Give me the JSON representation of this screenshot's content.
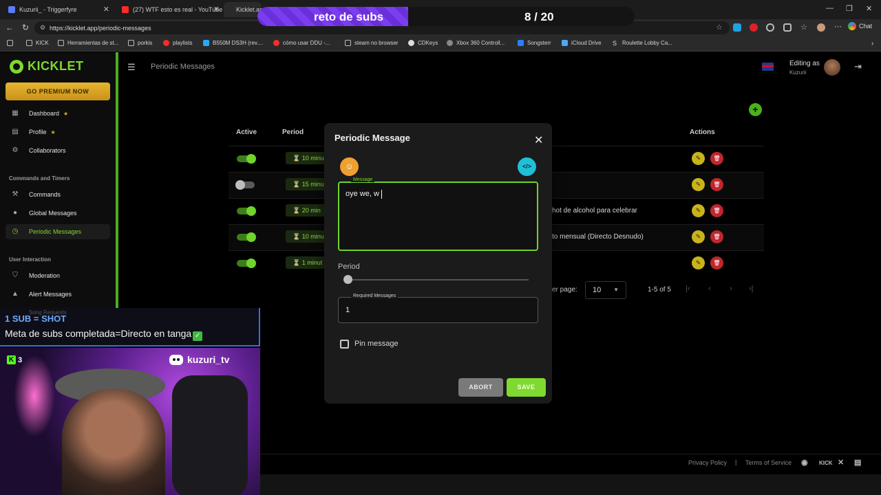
{
  "browser": {
    "tabs": [
      {
        "label": "Kuzurii_ - Triggerfyre",
        "color": "#5b7cff"
      },
      {
        "label": "(27) WTF esto es real - YouTube",
        "color": "#ff2a2a"
      },
      {
        "label": "Kicklet.ap",
        "color": "#53fc18"
      }
    ],
    "url": "https://kicklet.app/periodic-messages",
    "chat_label": "Chat",
    "bookmarks": [
      {
        "label": "KICK",
        "color": "#53fc18"
      },
      {
        "label": "Herramientas de st...",
        "color": "#cfcfcf"
      },
      {
        "label": "porkis",
        "color": "#cfcfcf"
      },
      {
        "label": "playlists",
        "color": "#ff2a2a"
      },
      {
        "label": "B550M DS3H (rev....",
        "color": "#2aa7ff"
      },
      {
        "label": "cómo usar DDU -...",
        "color": "#ff2a2a"
      },
      {
        "label": "steam no browser",
        "color": "#cfcfcf"
      },
      {
        "label": "CDKeys",
        "color": "#cfcfcf"
      },
      {
        "label": "Xbox 360 Controll...",
        "color": "#cfcfcf"
      },
      {
        "label": "Songsterr",
        "color": "#2a7fff"
      },
      {
        "label": "iCloud Drive",
        "color": "#4aa8ff"
      },
      {
        "label": "Roulette Lobby Ca...",
        "color": "#cfcfcf"
      }
    ]
  },
  "sub_goal": {
    "label": "reto de subs",
    "current": 8,
    "target": 20,
    "count_text": "8 / 20"
  },
  "sidebar": {
    "logo": "KICKLET",
    "premium": "GO PREMIUM NOW",
    "items": [
      {
        "label": "Dashboard",
        "icon": "dashboard-icon",
        "star": true
      },
      {
        "label": "Profile",
        "icon": "profile-icon",
        "star": true
      },
      {
        "label": "Collaborators",
        "icon": "collaborators-icon",
        "star": false
      }
    ],
    "section_commands": "Commands and Timers",
    "commands_items": [
      {
        "label": "Commands",
        "icon": "wrench-icon"
      },
      {
        "label": "Global Messages",
        "icon": "chat-icon"
      },
      {
        "label": "Periodic Messages",
        "icon": "clock-icon",
        "active": true
      }
    ],
    "section_user": "User Interaction",
    "user_items": [
      {
        "label": "Moderation",
        "icon": "shield-icon"
      },
      {
        "label": "Alert Messages",
        "icon": "warning-icon"
      }
    ],
    "faded_item": "Song Requests"
  },
  "header": {
    "page_title": "Periodic Messages",
    "editing_as": "Editing as",
    "username": "Kuzurii"
  },
  "table": {
    "headers": {
      "active": "Active",
      "period": "Period",
      "actions": "Actions"
    },
    "rows": [
      {
        "active": true,
        "period": "10 minu",
        "message": ""
      },
      {
        "active": false,
        "period": "15 minu",
        "message": ""
      },
      {
        "active": true,
        "period": "20 min",
        "message": "hot de alcohol para celebrar"
      },
      {
        "active": true,
        "period": "10 minu",
        "message": "to mensual (Directo Desnudo)"
      },
      {
        "active": true,
        "period": "1 minut",
        "message": ""
      }
    ],
    "rows_per_page_label": "er page:",
    "rows_per_page": "10",
    "range": "1-5 of 5"
  },
  "modal": {
    "title": "Periodic Message",
    "message_label": "Message",
    "message_value": "oye we, w",
    "period_label": "Period",
    "period_level": 0,
    "required_label": "Required Messages",
    "required_value": "1",
    "pin_label": "Pin message",
    "abort": "ABORT",
    "save": "SAVE"
  },
  "footer": {
    "privacy": "Privacy Policy",
    "separator": "|",
    "terms": "Terms of Service",
    "kick": "KICK"
  },
  "overlay": {
    "goal_line1": "1 SUB = SHOT",
    "goal_line2": "Meta de subs completada=Directo en tanga",
    "kick_count": "3",
    "discord_name": "kuzuri_tv"
  },
  "colors": {
    "accent": "#7fd92f",
    "danger": "#c0262d",
    "edit": "#c9b31b",
    "overlay_purple": "#7b3df0"
  }
}
